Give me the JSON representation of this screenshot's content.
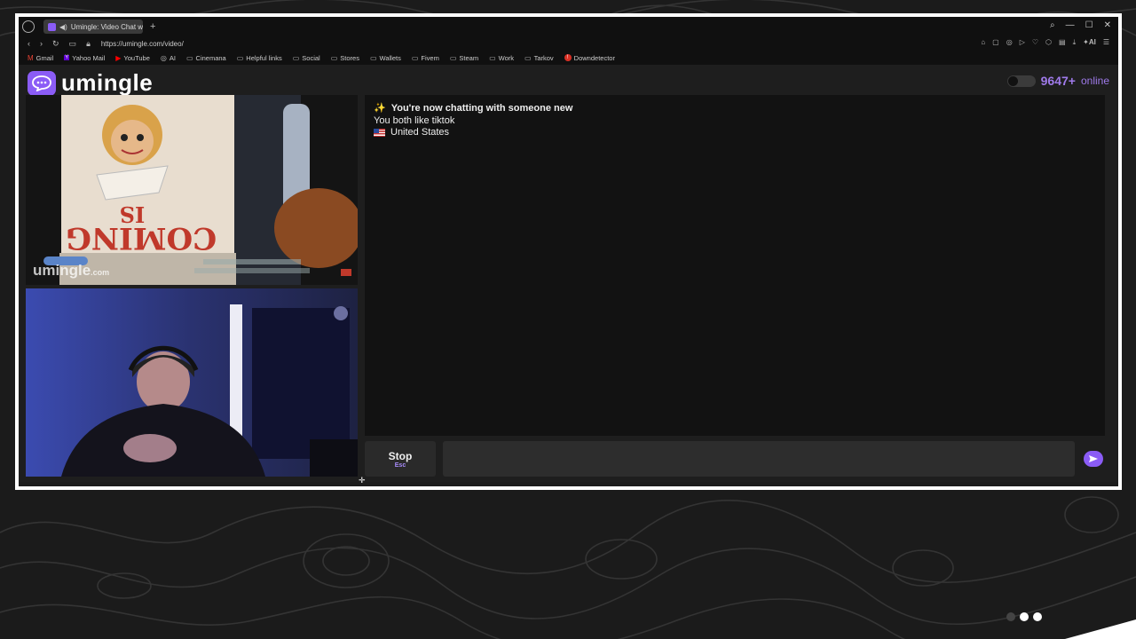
{
  "browser": {
    "tab_title": "Umingle: Video Chat w",
    "url": "https://umingle.com/video/",
    "new_tab": "+",
    "ai_label": "AI"
  },
  "bookmarks": [
    {
      "label": "Gmail",
      "icon": "gmail-icon"
    },
    {
      "label": "Yahoo Mail",
      "icon": "yahoo-icon"
    },
    {
      "label": "YouTube",
      "icon": "youtube-icon"
    },
    {
      "label": "AI",
      "icon": "ai-icon"
    },
    {
      "label": "Cinemana",
      "icon": "folder-icon"
    },
    {
      "label": "Helpful links",
      "icon": "folder-icon"
    },
    {
      "label": "Social",
      "icon": "folder-icon"
    },
    {
      "label": "Stores",
      "icon": "folder-icon"
    },
    {
      "label": "Wallets",
      "icon": "folder-icon"
    },
    {
      "label": "Fivem",
      "icon": "folder-icon"
    },
    {
      "label": "Steam",
      "icon": "folder-icon"
    },
    {
      "label": "Work",
      "icon": "folder-icon"
    },
    {
      "label": "Tarkov",
      "icon": "folder-icon"
    },
    {
      "label": "Downdetector",
      "icon": "downdetector-icon"
    }
  ],
  "site": {
    "logo": "umingle",
    "online_count": "9647+",
    "online_label": "online",
    "watermark": "umingle",
    "watermark_suffix": ".com"
  },
  "chat": {
    "messages": [
      {
        "icon": "sparkles-icon",
        "text": "You're now chatting with someone new"
      },
      {
        "text": "You both like tiktok"
      },
      {
        "icon": "us-flag-icon",
        "text": "United States"
      }
    ]
  },
  "controls": {
    "stop_label": "Stop",
    "stop_hint": "Esc",
    "message_placeholder": ""
  },
  "colors": {
    "accent": "#8b5cf6",
    "online": "#9f7aea",
    "frame": "#ffffff"
  }
}
